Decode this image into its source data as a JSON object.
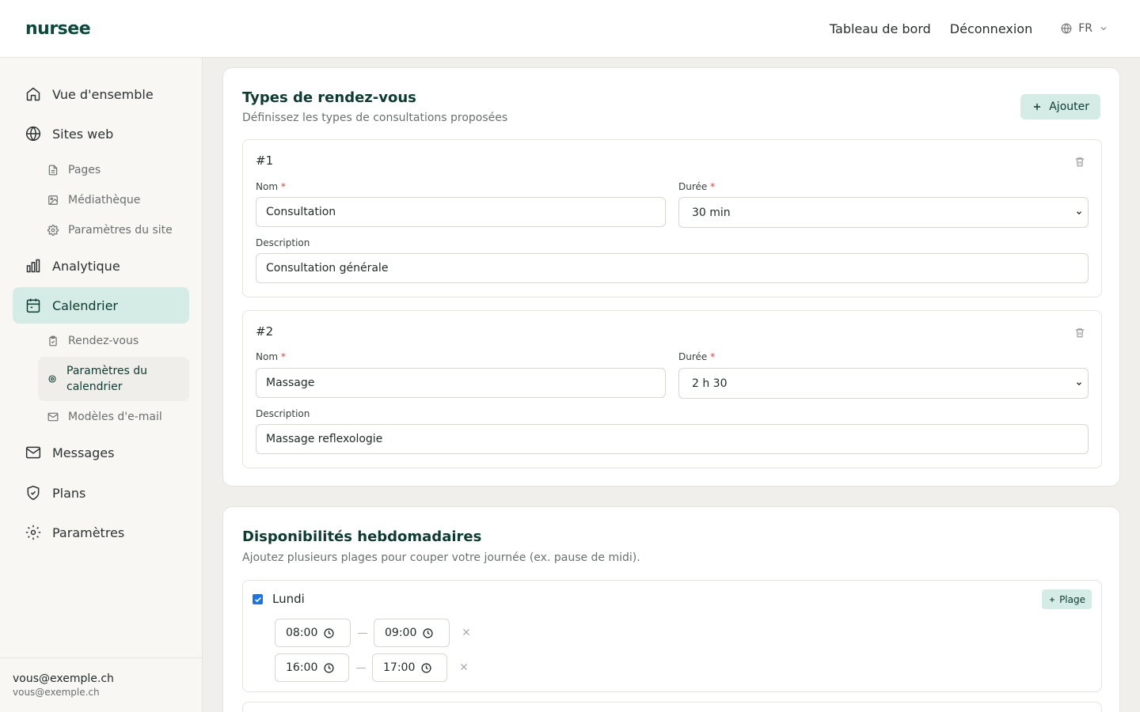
{
  "header": {
    "logo": "nursee",
    "nav": [
      "Tableau de bord",
      "Déconnexion"
    ],
    "lang": "FR"
  },
  "sidebar": {
    "items": [
      {
        "label": "Vue d'ensemble",
        "icon": "home-icon"
      },
      {
        "label": "Sites web",
        "icon": "globe-icon"
      },
      {
        "label": "Pages",
        "icon": "file-icon"
      },
      {
        "label": "Médiathèque",
        "icon": "image-icon"
      },
      {
        "label": "Paramètres du site",
        "icon": "gear-icon"
      },
      {
        "label": "Analytique",
        "icon": "bar-chart-icon"
      },
      {
        "label": "Calendrier",
        "icon": "calendar-icon"
      },
      {
        "label": "Rendez-vous",
        "icon": "clipboard-icon"
      },
      {
        "label": "Paramètres du calendrier",
        "icon": "gear-icon"
      },
      {
        "label": "Modèles d'e-mail",
        "icon": "mail-icon"
      },
      {
        "label": "Messages",
        "icon": "mail-icon"
      },
      {
        "label": "Plans",
        "icon": "shield-icon"
      },
      {
        "label": "Paramètres",
        "icon": "gear-icon"
      }
    ],
    "user_email": "vous@exemple.ch",
    "user_email_secondary": "vous@exemple.ch"
  },
  "types": {
    "title": "Types de rendez-vous",
    "subtitle": "Définissez les types de consultations proposées",
    "add_label": "Ajouter",
    "name_label": "Nom",
    "duration_label": "Durée",
    "description_label": "Description",
    "required_mark": "*",
    "items": [
      {
        "num": "#1",
        "name": "Consultation",
        "duration": "30 min",
        "description": "Consultation générale"
      },
      {
        "num": "#2",
        "name": "Massage",
        "duration": "2 h 30",
        "description": "Massage reflexologie"
      }
    ]
  },
  "availability": {
    "title": "Disponibilités hebdomadaires",
    "subtitle": "Ajoutez plusieurs plages pour couper votre journée (ex. pause de midi).",
    "plage_label": "Plage",
    "days": [
      {
        "name": "Lundi",
        "checked": true,
        "slots": [
          {
            "start": "08:00",
            "end": "09:00"
          },
          {
            "start": "16:00",
            "end": "17:00"
          }
        ]
      }
    ]
  },
  "colors": {
    "brand": "#0d4a3d",
    "accent_bg": "#d4ece5",
    "required": "#d64545",
    "checkbox": "#1a73e8"
  }
}
